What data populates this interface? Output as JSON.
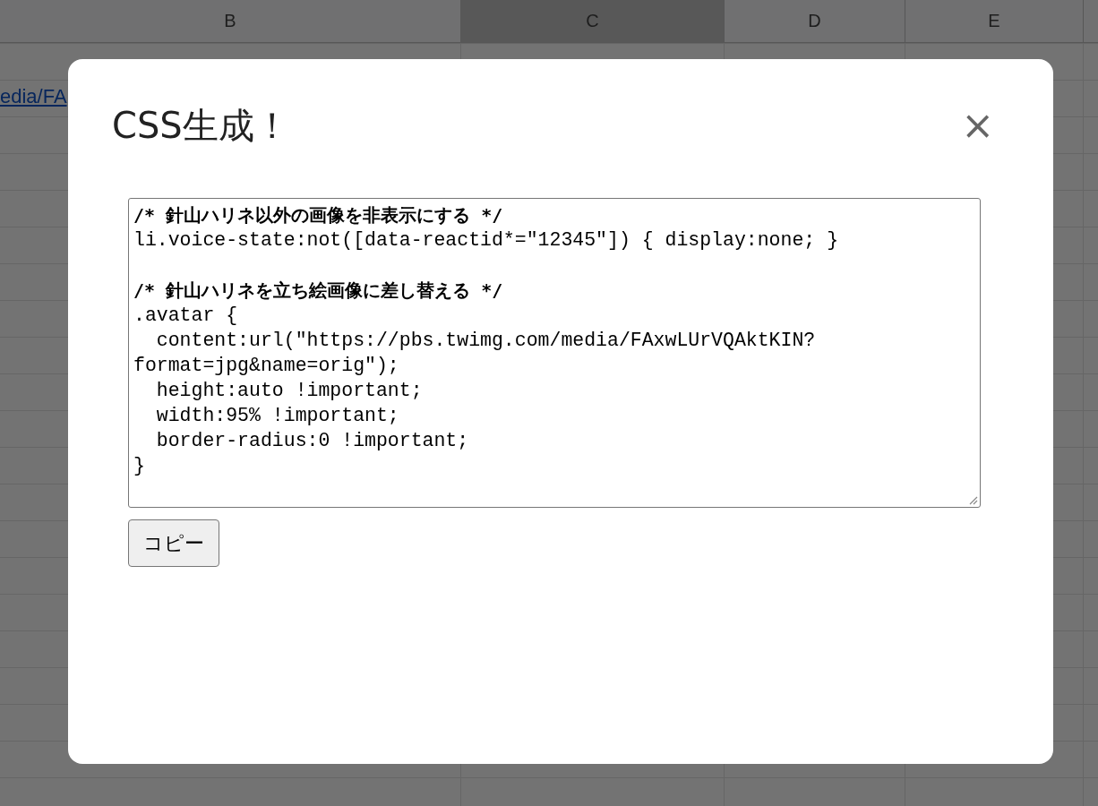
{
  "sheet": {
    "columns": [
      {
        "label": "B",
        "selected": false
      },
      {
        "label": "C",
        "selected": true
      },
      {
        "label": "D",
        "selected": false
      },
      {
        "label": "E",
        "selected": false
      }
    ],
    "link": "edia/FA"
  },
  "dialog": {
    "title": "CSS生成！",
    "close": "×",
    "code_lines": [
      {
        "text": "/* 針山ハリネ以外の画像を非表示にする */",
        "kind": "comment",
        "gap_before": false
      },
      {
        "text": "li.voice-state:not([data-reactid*=\"12345\"]) { display:none; }",
        "kind": "code",
        "gap_before": false
      },
      {
        "text": "/* 針山ハリネを立ち絵画像に差し替える */",
        "kind": "comment",
        "gap_before": true
      },
      {
        "text": ".avatar {",
        "kind": "code",
        "gap_before": false
      },
      {
        "text": "  content:url(\"https://pbs.twimg.com/media/FAxwLUrVQAktKIN?",
        "kind": "code",
        "gap_before": false
      },
      {
        "text": "format=jpg&name=orig\");",
        "kind": "code",
        "gap_before": false
      },
      {
        "text": "  height:auto !important;",
        "kind": "code",
        "gap_before": false
      },
      {
        "text": "  width:95% !important;",
        "kind": "code",
        "gap_before": false
      },
      {
        "text": "  border-radius:0 !important;",
        "kind": "code",
        "gap_before": false
      },
      {
        "text": "}",
        "kind": "code",
        "gap_before": false
      }
    ],
    "button": "コピー"
  }
}
